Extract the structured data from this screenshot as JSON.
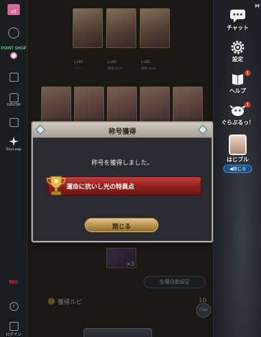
{
  "sidebar_left": {
    "gift_label": "4月",
    "point_shop_label": "POINT SHOP",
    "video_label": "GBVSR",
    "skyleap_label": "SkyLeap",
    "rec_label": "REC",
    "logout_label": "ログイン"
  },
  "game": {
    "party_row1": [
      {
        "level": "Lv80",
        "sub": "────"
      },
      {
        "level": "Lv80",
        "sub": "最終:00:00"
      },
      {
        "level": "Lv80",
        "sub": "最終:00:00"
      }
    ],
    "reward_count": "×3",
    "auto_button": "全種自動設定",
    "ruby_label": "獲得ルピ",
    "ruby_value": "10",
    "chat_label": "Chat"
  },
  "dialog": {
    "title": "称号獲得",
    "message": "称号を獲得しました。",
    "achievement_title": "運命に抗いし光の特異点",
    "close_button": "閉じる"
  },
  "sidebar_right": {
    "chat": "チャット",
    "settings": "設定",
    "help": "ヘルプ",
    "gurabburu": "ぐらぶるっ！",
    "hajiburu": "はじブル",
    "close": "◀閉じる",
    "help_badge": "!",
    "gurabburu_badge": "!",
    "menu_letter": "M"
  },
  "colors": {
    "banner_red": "#a82828",
    "gold_button": "#c9a666",
    "dialog_bg": "#2a2a30",
    "header_silver": "#bdb8ae",
    "notif_red": "#d23a2e",
    "close_pill_blue": "#1e4f8a"
  }
}
